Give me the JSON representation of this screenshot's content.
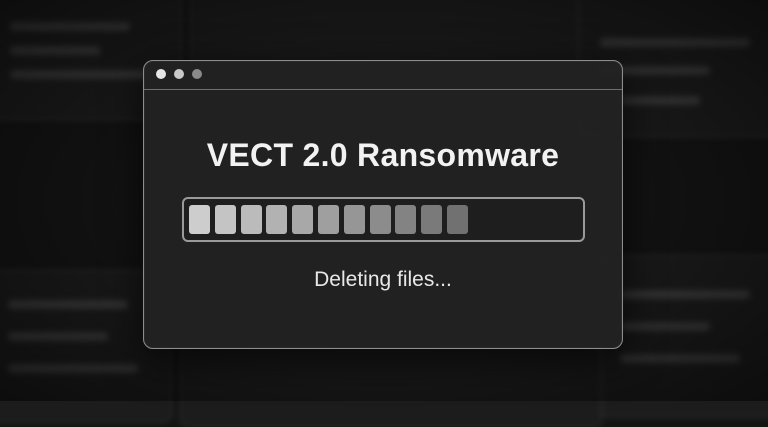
{
  "window": {
    "title": "VECT 2.0 Ransomware",
    "status_text": "Deleting files...",
    "progress": {
      "filled_segments": 11,
      "segment_colors": [
        "#cdcdcd",
        "#c4c4c4",
        "#bbbbbb",
        "#b2b2b2",
        "#a8a8a8",
        "#9f9f9f",
        "#969696",
        "#8c8c8c",
        "#838383",
        "#7a7a7a",
        "#717171"
      ]
    }
  },
  "window_controls": [
    "close-icon",
    "minimize-icon",
    "maximize-icon"
  ]
}
